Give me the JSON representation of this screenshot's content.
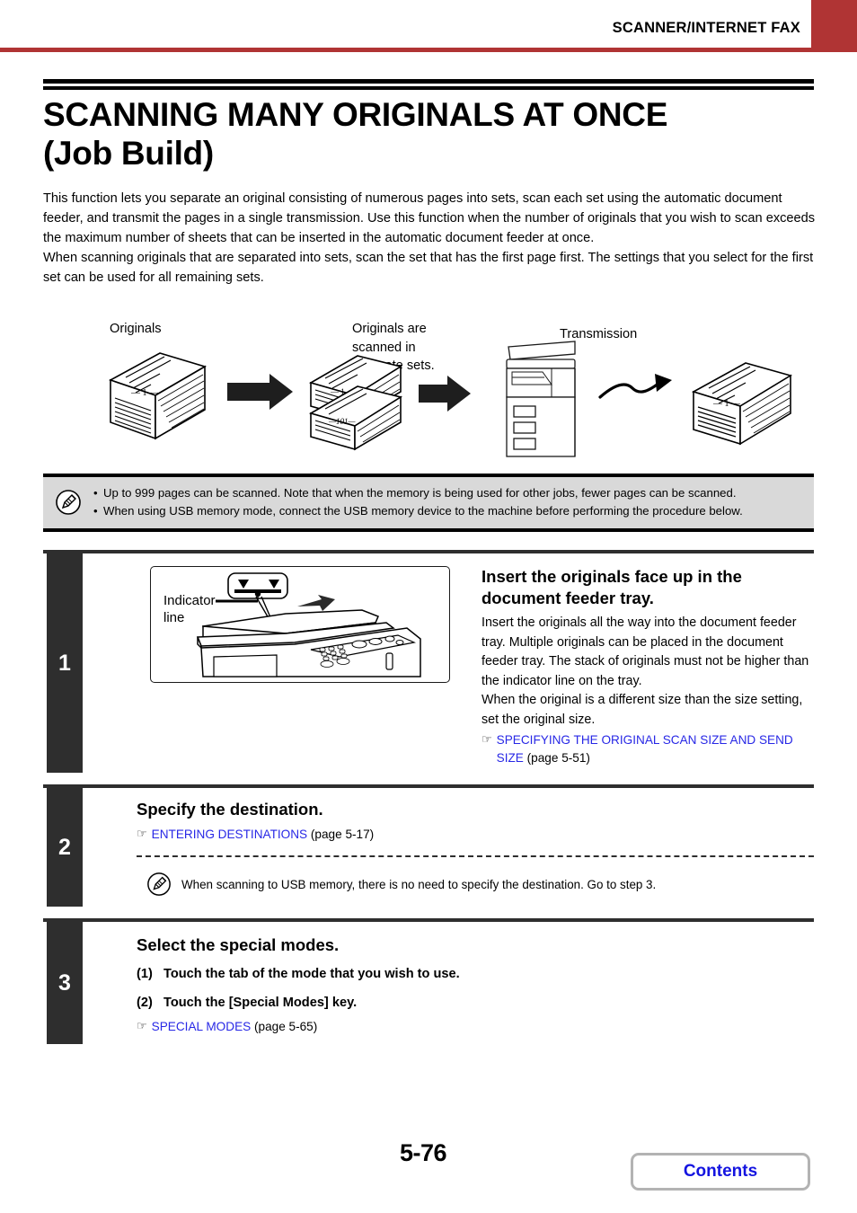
{
  "header": {
    "section_title": "SCANNER/INTERNET FAX",
    "accent_color": "#b03434"
  },
  "title": {
    "line1": "SCANNING MANY ORIGINALS AT ONCE",
    "line2": "(Job Build)"
  },
  "intro": {
    "paragraph1": "This function lets you separate an original consisting of numerous pages into sets, scan each set using the automatic document feeder, and transmit the pages in a single transmission. Use this function when the number of originals that you wish to scan exceeds the maximum number of sheets that can be inserted in the automatic document feeder at once.",
    "paragraph2": "When scanning originals that are separated into sets, scan the set that has the first page first. The settings that you select for the first set can be used for all remaining sets."
  },
  "diagram": {
    "label_originals": "Originals",
    "label_separate_sets": "Originals are scanned in separate sets.",
    "label_transmission": "Transmission",
    "stack_page_first": "— 1 —",
    "stack_page_101": "—101—"
  },
  "note_box": {
    "icon": "pencil-note-icon",
    "bullet": "•",
    "items": [
      "Up to 999 pages can be scanned. Note that when the memory is being used for other jobs, fewer pages can be scanned.",
      "When using USB memory mode, connect the USB memory device to the machine before performing the procedure below."
    ]
  },
  "steps": [
    {
      "number": "1",
      "heading": "Insert the originals face up in the document feeder tray.",
      "body": "Insert the originals all the way into the document feeder tray. Multiple originals can be placed in the document feeder tray. The stack of originals must not be higher than the indicator line on the tray.\nWhen the original is a different size than the size setting, set the original size.",
      "illustration": {
        "caption_line1": "Indicator",
        "caption_line2": "line",
        "alt": "machine-document-feeder-illustration"
      },
      "xref": {
        "icon": "☞",
        "link": "SPECIFYING THE ORIGINAL SCAN SIZE AND SEND SIZE",
        "page": "(page 5-51)"
      }
    },
    {
      "number": "2",
      "heading": "Specify the destination.",
      "xref": {
        "icon": "☞",
        "link": "ENTERING DESTINATIONS",
        "page": "(page 5-17)"
      },
      "inline_note": {
        "icon": "pencil-note-icon",
        "text": "When scanning to USB memory, there is no need to specify the destination. Go to step 3."
      }
    },
    {
      "number": "3",
      "heading": "Select the special modes.",
      "substeps": [
        {
          "num": "(1)",
          "text": "Touch the tab of the mode that you wish to use."
        },
        {
          "num": "(2)",
          "text": "Touch the [Special Modes] key."
        }
      ],
      "xref": {
        "icon": "☞",
        "link": "SPECIAL MODES",
        "page": "(page 5-65)"
      }
    }
  ],
  "footer": {
    "page_number": "5-76",
    "contents_button": "Contents",
    "link_color": "#1414e0"
  }
}
